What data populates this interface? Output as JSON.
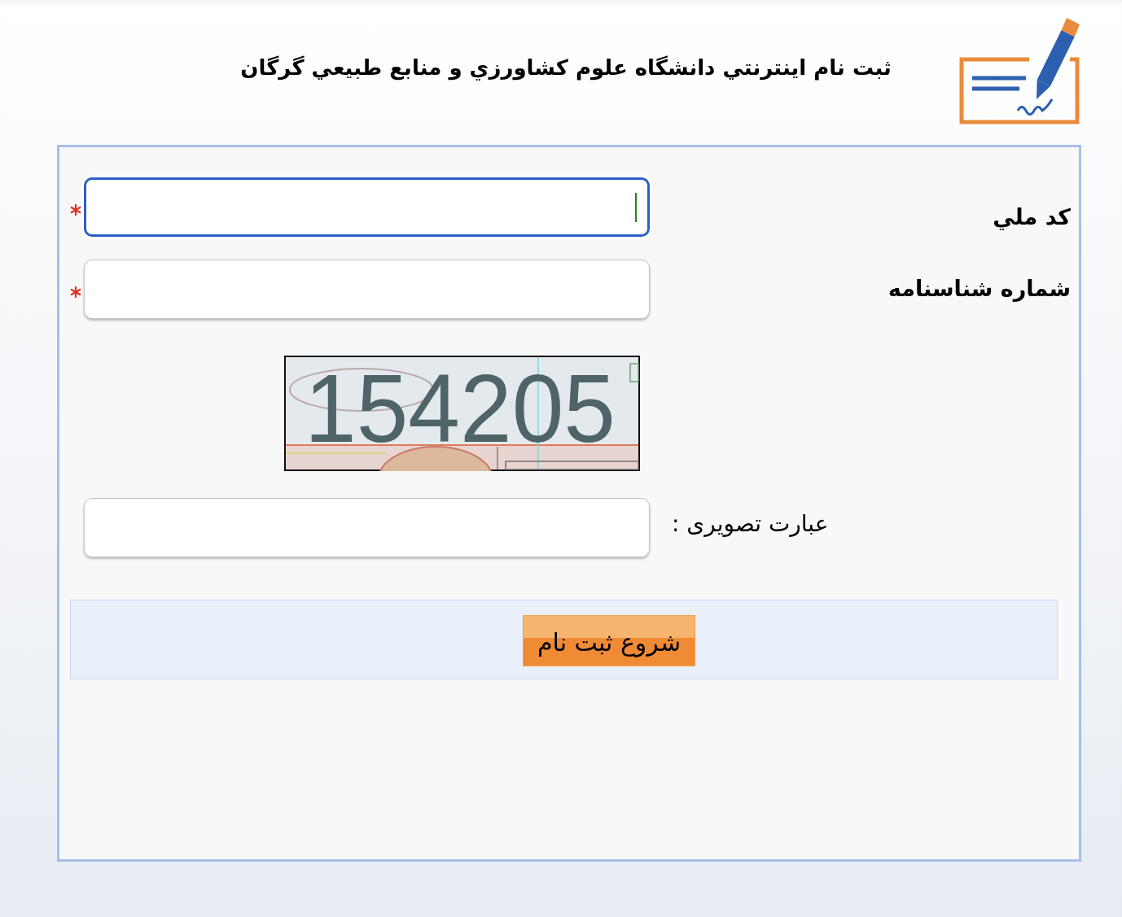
{
  "header": {
    "title": "ثبت نام اينترنتي دانشگاه علوم كشاورزي و منابع طبيعي گرگان"
  },
  "form": {
    "fields": [
      {
        "kind": "input",
        "label": "كد ملي",
        "required": true,
        "focused": true
      },
      {
        "kind": "input",
        "label": "شماره شناسنامه",
        "required": true,
        "focused": false
      },
      {
        "kind": "captcha_image",
        "text": "154205"
      },
      {
        "kind": "captcha_input",
        "label": "عبارت تصویری :",
        "required": false,
        "focused": false
      }
    ],
    "submit_button": {
      "label": "شروع ثبت نام"
    }
  }
}
